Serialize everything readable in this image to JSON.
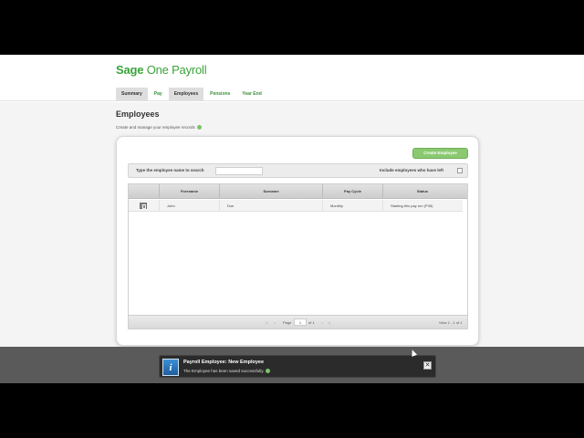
{
  "app": {
    "logo_brand": "Sage",
    "logo_product": "One Payroll"
  },
  "nav": {
    "tabs": [
      {
        "label": "Summary",
        "active": true
      },
      {
        "label": "Pay",
        "active": false
      },
      {
        "label": "Employees",
        "active": true
      },
      {
        "label": "Pensions",
        "active": false
      },
      {
        "label": "Year End",
        "active": false
      }
    ]
  },
  "page": {
    "title": "Employees",
    "description": "Create and manage your employee records"
  },
  "toolbar": {
    "create_label": "Create Employee"
  },
  "search": {
    "label": "Type the employee name to search",
    "value": "",
    "include_left_label": "Include employees who have left",
    "include_left_checked": false
  },
  "grid": {
    "columns": [
      "Forename",
      "Surname",
      "Pay Cycle",
      "Status"
    ],
    "rows": [
      {
        "forename": "John",
        "surname": "Doe",
        "pay_cycle": "Monthly",
        "status": "Starting this pay run (P45)"
      }
    ],
    "pager": {
      "page_label": "Page",
      "page_value": "1",
      "of_label": "of 1",
      "view_info": "View 1 - 1 of 1"
    }
  },
  "notification": {
    "title": "Payroll Employee: New Employee",
    "message": "The Employee has been saved successfully."
  },
  "colors": {
    "brand_green": "#3aa33a",
    "button_green": "#8bc971",
    "toast_bg": "#2b2b2b",
    "overlay": "#5a5a5a"
  },
  "icons": {
    "toast": "info-icon",
    "close": "close-icon",
    "edit": "edit-icon",
    "help": "help-icon"
  }
}
